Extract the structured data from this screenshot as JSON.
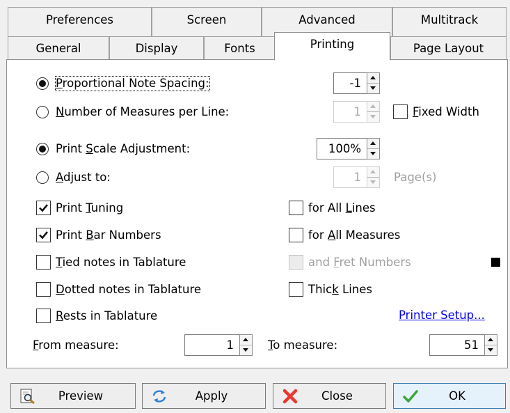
{
  "tabs_row1": [
    {
      "label": "Preferences"
    },
    {
      "label": "Screen"
    },
    {
      "label": "Advanced"
    },
    {
      "label": "Multitrack"
    }
  ],
  "tabs_row2": [
    {
      "label": "General"
    },
    {
      "label": "Display"
    },
    {
      "label": "Fonts"
    },
    {
      "label": "Printing",
      "active": true
    },
    {
      "label": "Page Layout"
    }
  ],
  "printing": {
    "proportional": {
      "label_u": "P",
      "label_rest": "roportional Note Spacing:",
      "selected": true,
      "value": "-1"
    },
    "measures_per_line": {
      "label_u": "N",
      "label_rest": "umber of Measures per Line:",
      "selected": false,
      "value": "1"
    },
    "fixed_width": {
      "label_u": "F",
      "label_rest": "ixed Width",
      "checked": false
    },
    "print_scale": {
      "label_pre": "Print ",
      "label_u": "S",
      "label_rest": "cale Adjustment:",
      "selected": true,
      "value": "100%"
    },
    "adjust_to": {
      "label_u": "A",
      "label_rest": "djust to:",
      "selected": false,
      "value": "1",
      "unit": "Page(s)"
    },
    "print_tuning": {
      "label_pre": "Print ",
      "label_u": "T",
      "label_rest": "uning",
      "checked": true
    },
    "for_all_lines": {
      "label_pre": "for All ",
      "label_u": "L",
      "label_rest": "ines",
      "checked": false
    },
    "print_bar_numbers": {
      "label_pre": "Print ",
      "label_u": "B",
      "label_rest": "ar Numbers",
      "checked": true
    },
    "for_all_measures": {
      "label_pre": "for ",
      "label_u": "A",
      "label_rest": "ll Measures",
      "checked": false
    },
    "tied_notes": {
      "label_u": "T",
      "label_rest": "ied notes in Tablature",
      "checked": false
    },
    "and_fret_numbers": {
      "label_pre": "and ",
      "label_u": "F",
      "label_rest": "ret Numbers",
      "checked": false,
      "disabled": true
    },
    "dotted_notes": {
      "label_u": "D",
      "label_rest": "otted notes in Tablature",
      "checked": false
    },
    "thick_lines": {
      "label_pre": "Thic",
      "label_u": "k",
      "label_rest": " Lines",
      "checked": false
    },
    "rests": {
      "label_u": "R",
      "label_rest": "ests in Tablature",
      "checked": false
    },
    "printer_setup": "Printer Setup...",
    "from_measure": {
      "label_u": "F",
      "label_rest": "rom measure:",
      "value": "1"
    },
    "to_measure": {
      "label_u": "T",
      "label_rest": "o measure:",
      "value": "51"
    }
  },
  "buttons": {
    "preview": "Preview",
    "apply": "Apply",
    "close": "Close",
    "ok": "OK"
  },
  "colors": {
    "link": "#0000ee",
    "ok_border": "#3c7fb1",
    "close_icon": "#e8382f",
    "ok_icon": "#3aa63a"
  }
}
